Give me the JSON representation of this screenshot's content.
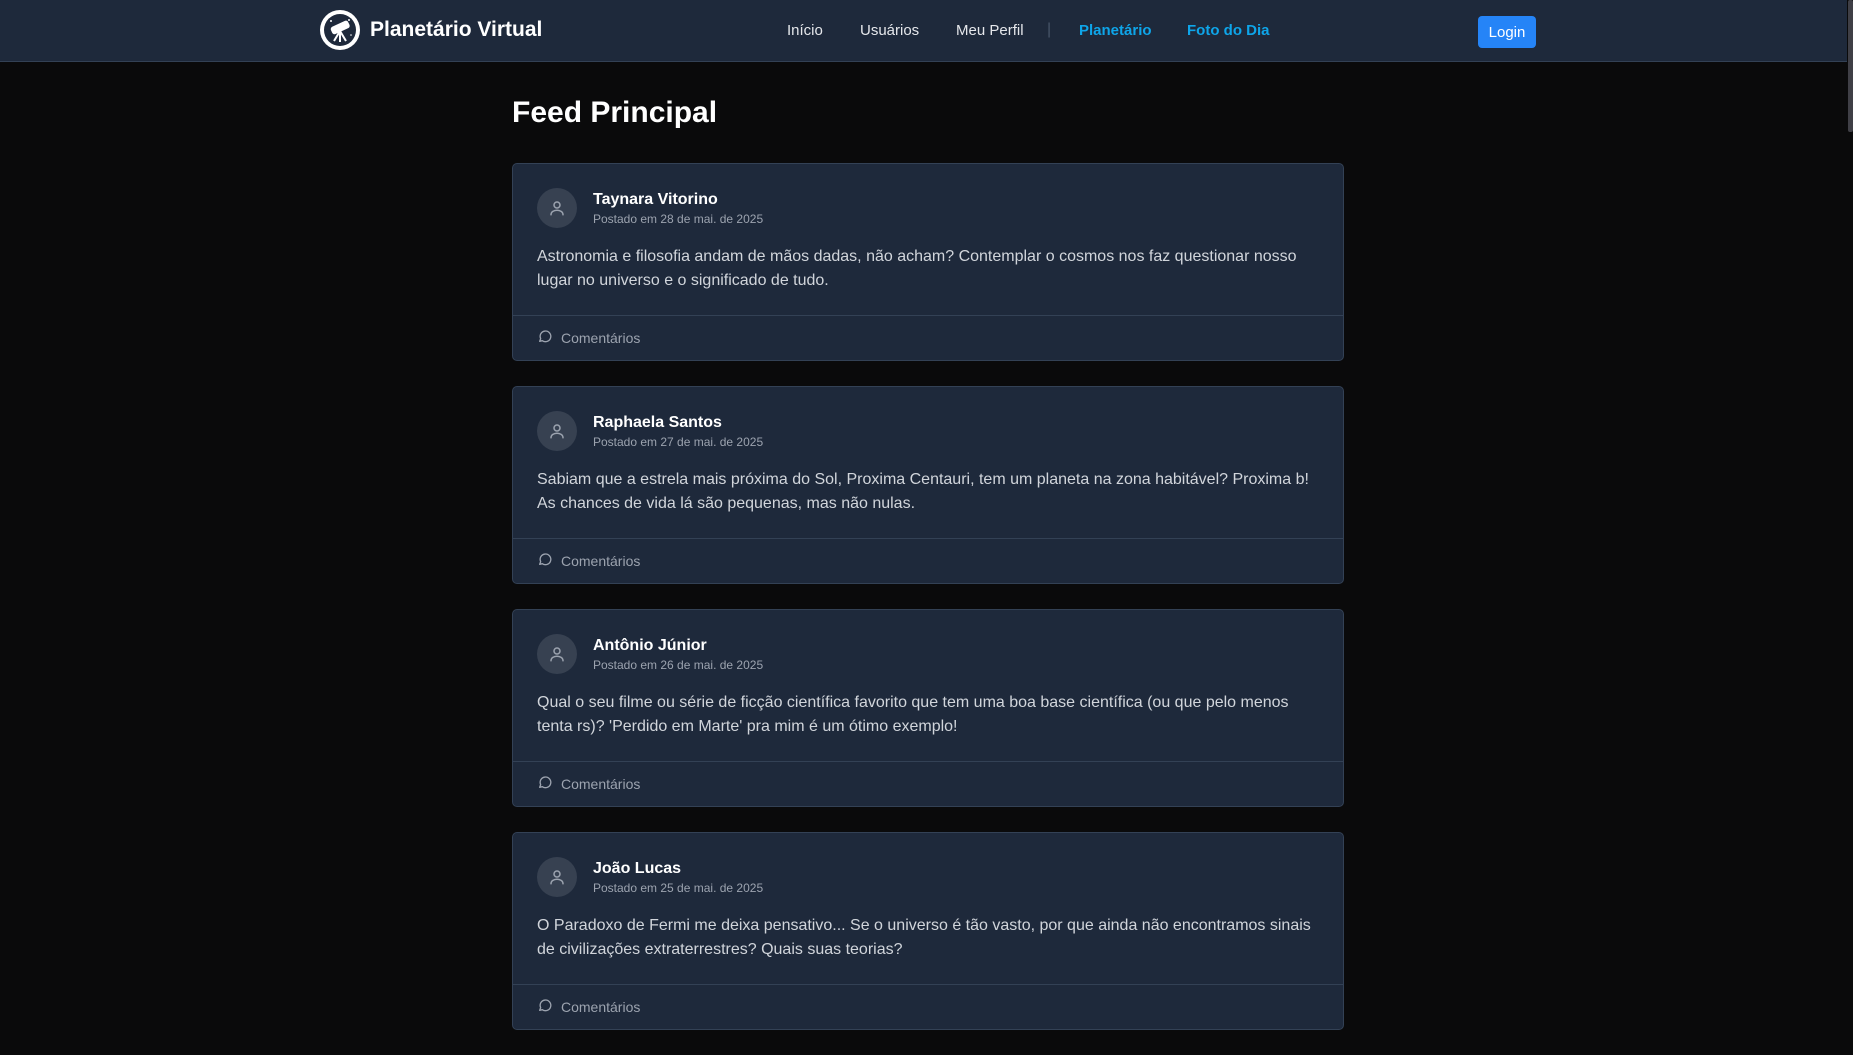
{
  "nav": {
    "brand": "Planetário Virtual",
    "links": [
      "Início",
      "Usuários",
      "Meu Perfil"
    ],
    "accent_links": [
      "Planetário",
      "Foto do Dia"
    ],
    "separator": "|",
    "login": "Login"
  },
  "main": {
    "title": "Feed Principal",
    "posts": [
      {
        "author": "Taynara Vitorino",
        "date": "Postado em 28 de mai. de 2025",
        "content": "Astronomia e filosofia andam de mãos dadas, não acham? Contemplar o cosmos nos faz questionar nosso lugar no universo e o significado de tudo.",
        "comments_label": "Comentários"
      },
      {
        "author": "Raphaela Santos",
        "date": "Postado em 27 de mai. de 2025",
        "content": "Sabiam que a estrela mais próxima do Sol, Proxima Centauri, tem um planeta na zona habitável? Proxima b! As chances de vida lá são pequenas, mas não nulas.",
        "comments_label": "Comentários"
      },
      {
        "author": "Antônio Júnior",
        "date": "Postado em 26 de mai. de 2025",
        "content": "Qual o seu filme ou série de ficção científica favorito que tem uma boa base científica (ou que pelo menos tenta rs)? 'Perdido em Marte' pra mim é um ótimo exemplo!",
        "comments_label": "Comentários"
      },
      {
        "author": "João Lucas",
        "date": "Postado em 25 de mai. de 2025",
        "content": "O Paradoxo de Fermi me deixa pensativo... Se o universo é tão vasto, por que ainda não encontramos sinais de civilizações extraterrestres? Quais suas teorias?",
        "comments_label": "Comentários"
      }
    ]
  },
  "icons": {
    "brand": "telescope-icon",
    "avatar": "user-icon",
    "comments": "comment-icon"
  },
  "colors": {
    "navbar_bg": "#1e293b",
    "page_bg": "#0a0a0b",
    "card_bg": "#1e293b",
    "accent": "#0ea5e9",
    "login_button": "#2584f7"
  }
}
